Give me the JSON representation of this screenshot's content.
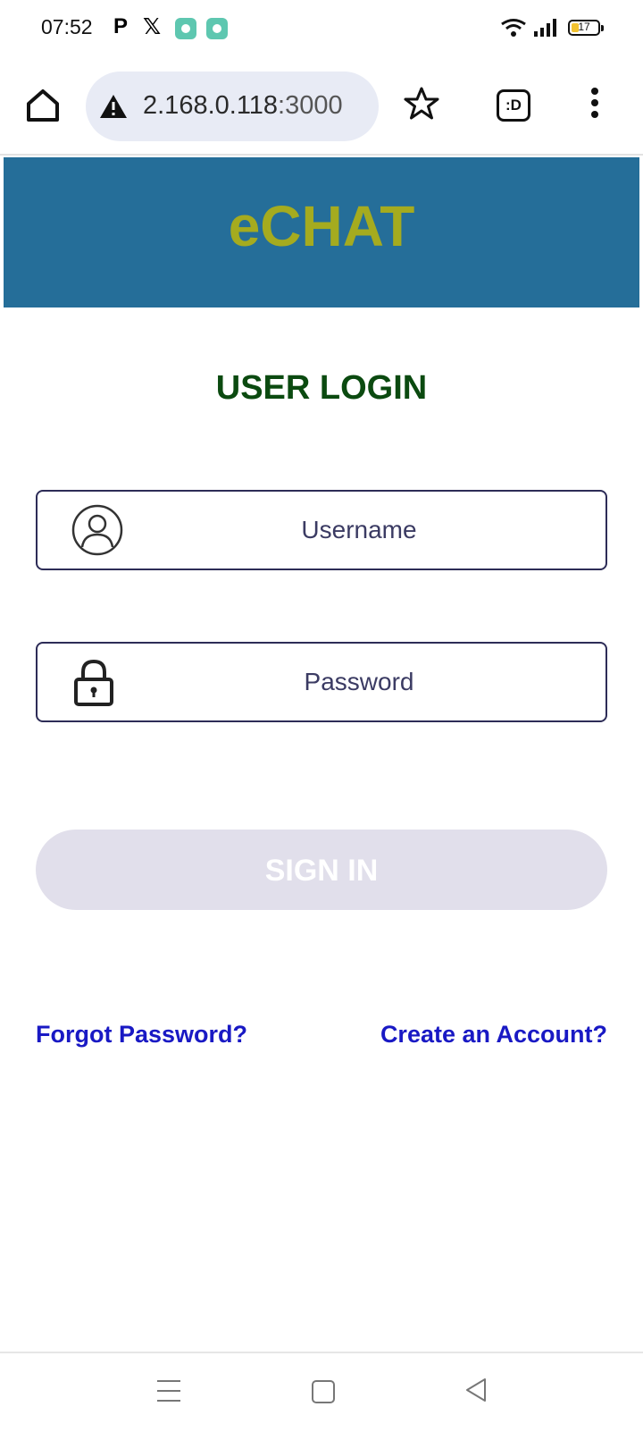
{
  "status_bar": {
    "time": "07:52",
    "battery_level": "17",
    "icons": [
      "p-icon",
      "x-icon",
      "app-badge-icon",
      "app-badge-icon",
      "wifi-icon",
      "signal-icon",
      "battery-icon"
    ]
  },
  "browser": {
    "url": "2.168.0.118",
    "url_port": ":3000",
    "tabs_label": ":D",
    "icons": [
      "home-icon",
      "warning-icon",
      "star-icon",
      "tabs-icon",
      "more-vert-icon"
    ]
  },
  "header": {
    "brand": "eCHAT",
    "background_color": "#256e99",
    "brand_color": "#a5ab1f"
  },
  "login": {
    "title": "USER LOGIN",
    "username_placeholder": "Username",
    "username_value": "",
    "password_placeholder": "Password",
    "password_value": "",
    "signin_label": "SIGN IN",
    "forgot_label": "Forgot Password?",
    "create_label": "Create an Account?",
    "title_color": "#0b4a10",
    "link_color": "#1919c4",
    "button_color": "#e1dfeb"
  },
  "nav_bar": {
    "icons": [
      "recent-apps-icon",
      "home-square-icon",
      "back-triangle-icon"
    ]
  }
}
